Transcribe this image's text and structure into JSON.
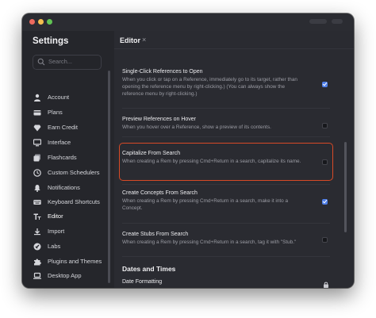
{
  "sidebar": {
    "title": "Settings",
    "search_placeholder": "Search...",
    "items": [
      {
        "label": "Account",
        "icon": "person-icon"
      },
      {
        "label": "Plans",
        "icon": "credit-card-icon"
      },
      {
        "label": "Earn Credit",
        "icon": "diamond-icon"
      },
      {
        "label": "Interface",
        "icon": "monitor-icon"
      },
      {
        "label": "Flashcards",
        "icon": "flashcards-icon"
      },
      {
        "label": "Custom Schedulers",
        "icon": "clock-icon"
      },
      {
        "label": "Notifications",
        "icon": "bell-icon"
      },
      {
        "label": "Keyboard Shortcuts",
        "icon": "keyboard-icon"
      },
      {
        "label": "Editor",
        "icon": "text-format-icon"
      },
      {
        "label": "Import",
        "icon": "import-icon"
      },
      {
        "label": "Labs",
        "icon": "rocket-icon"
      },
      {
        "label": "Plugins and Themes",
        "icon": "puzzle-icon"
      },
      {
        "label": "Desktop App",
        "icon": "laptop-icon"
      }
    ],
    "active": "Editor"
  },
  "main": {
    "title": "Editor",
    "close": "×",
    "settings": [
      {
        "title": "Single-Click References to Open",
        "description": "When you click or tap on a Reference, immediately go to its target, rather than opening the reference menu by right-clicking.) (You can always show the reference menu by right-clicking.)",
        "checked": true
      },
      {
        "title": "Preview References on Hover",
        "description": "When you hover over a Reference, show a preview of its contents.",
        "checked": false
      },
      {
        "title": "Capitalize From Search",
        "description": "When creating a Rem by pressing Cmd+Return in a search, capitalize its name.",
        "checked": false
      },
      {
        "title": "Create Concepts From Search",
        "description": "When creating a Rem by pressing Cmd+Return in a search, make it into a Concept.",
        "checked": true
      },
      {
        "title": "Create Stubs From Search",
        "description": "When creating a Rem by pressing Cmd+Return in a search, tag it with \"Stub.\"",
        "checked": false
      }
    ],
    "section": "Dates and Times",
    "subsection": "Date Formatting"
  },
  "colors": {
    "accent": "#4f7fe8",
    "highlight": "#d84a26"
  }
}
